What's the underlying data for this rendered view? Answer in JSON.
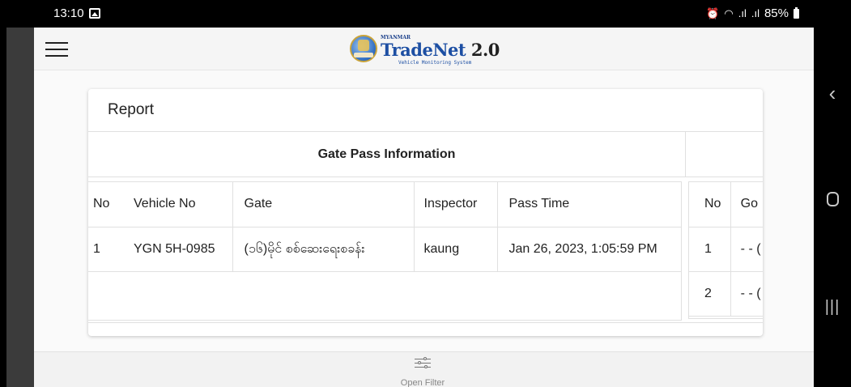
{
  "status_bar": {
    "time": "13:10",
    "battery": "85%",
    "icons": [
      "image-icon",
      "alarm-icon",
      "wifi-icon",
      "signal-icon",
      "signal-icon",
      "battery-icon"
    ]
  },
  "header": {
    "logo_top": "MYANMAR",
    "logo_brand": "TradeNet",
    "logo_version": " 2.0",
    "logo_sub": "Vehicle Monitoring System"
  },
  "report": {
    "title": "Report",
    "section_title": "Gate Pass Information",
    "columns": [
      "No",
      "Vehicle No",
      "Gate",
      "Inspector",
      "Pass Time"
    ],
    "rows": [
      {
        "no": "1",
        "vehicle_no": "YGN 5H-0985",
        "gate": "(၁၆)မိုင် စစ်ဆေးရေးစခန်း",
        "inspector": "kaung",
        "pass_time": "Jan 26, 2023, 1:05:59 PM"
      }
    ],
    "side_columns": [
      "No",
      "Go"
    ],
    "side_rows": [
      {
        "no": "1",
        "value": "- - ("
      },
      {
        "no": "2",
        "value": "- - ("
      }
    ]
  },
  "filter": {
    "label": "Open Filter"
  }
}
